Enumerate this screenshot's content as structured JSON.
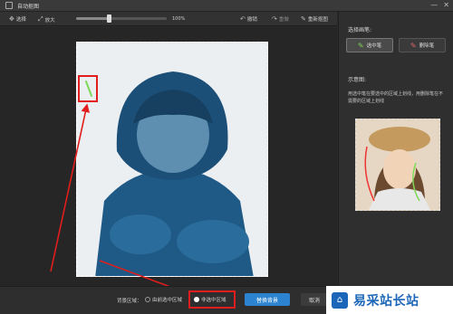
{
  "window": {
    "title": "自动抠图",
    "controls": [
      "—",
      "✕"
    ]
  },
  "toolbar": {
    "select_label": "选择",
    "enlarge_label": "放大",
    "zoom_value": "100%",
    "zoom_fraction": 0.36,
    "undo_label": "撤销",
    "redo_label": "重做",
    "redraw_label": "重新抠图"
  },
  "sidebar": {
    "choose_pen_title": "选择画笔:",
    "select_pen_label": "选中笔",
    "erase_pen_label": "删除笔",
    "example_title": "示意图:",
    "hint_text": "用选中笔在要选中的区域上划线，用删除笔在不需要的区域上划线"
  },
  "bottombar": {
    "bg_label": "背景区域：",
    "option_keep": "由前选中区域",
    "option_nonselected": "非选中区域",
    "replace_bg_button": "替换背景",
    "cancel_button": "取消"
  },
  "watermark": {
    "text": "易采站长站"
  },
  "colors": {
    "accent": "#2c83d0",
    "annotation": "#e11d1d",
    "select_stroke": "#7ed957"
  }
}
